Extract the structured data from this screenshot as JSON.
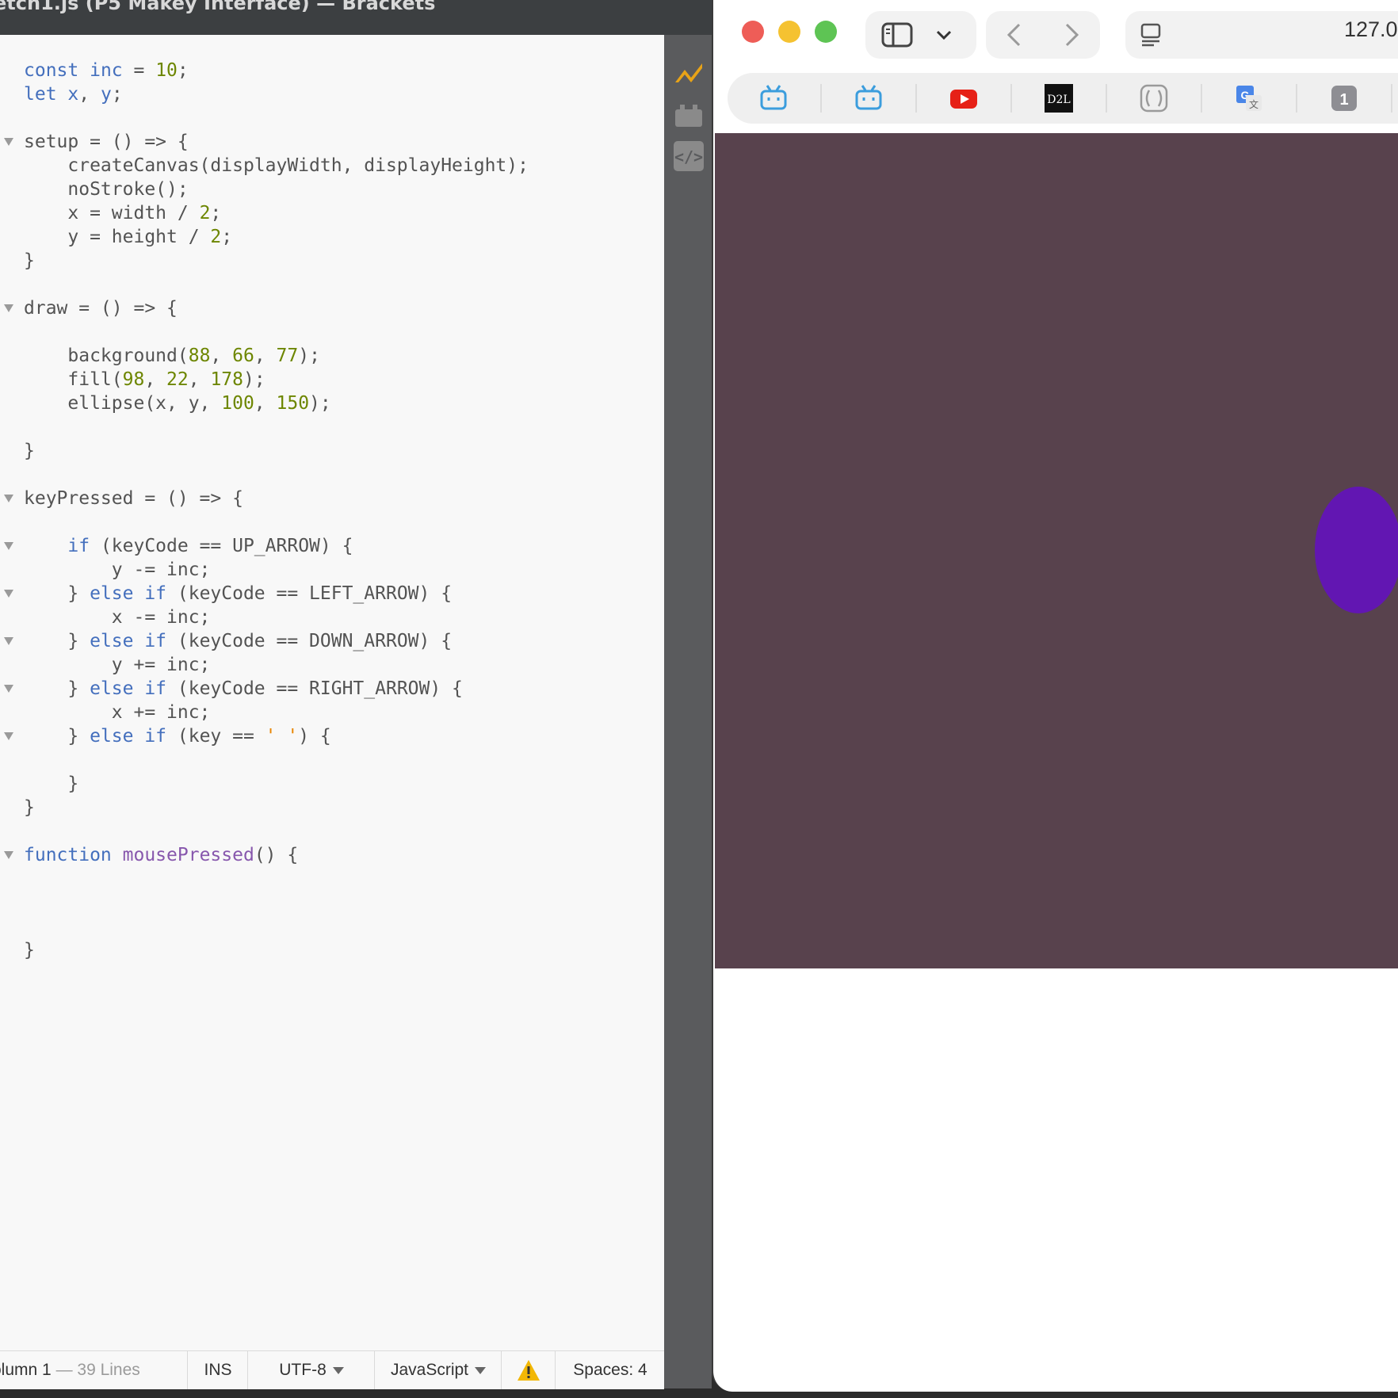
{
  "editor": {
    "title": "etch1.js (P5 Makey Interface) — Brackets",
    "code_lines": [
      {
        "fold": false,
        "html": "<span class=\"kw\">const</span> <span class=\"v\">inc</span> = <span class=\"num\">10</span>;"
      },
      {
        "fold": false,
        "html": "<span class=\"kw\">let</span> <span class=\"v\">x</span>, <span class=\"v\">y</span>;"
      },
      {
        "fold": false,
        "html": ""
      },
      {
        "fold": true,
        "html": "setup = () => {"
      },
      {
        "fold": false,
        "html": "    createCanvas(displayWidth, displayHeight);"
      },
      {
        "fold": false,
        "html": "    noStroke();"
      },
      {
        "fold": false,
        "html": "    x = width / <span class=\"num\">2</span>;"
      },
      {
        "fold": false,
        "html": "    y = height / <span class=\"num\">2</span>;"
      },
      {
        "fold": false,
        "html": "}"
      },
      {
        "fold": false,
        "html": ""
      },
      {
        "fold": true,
        "html": "draw = () => {"
      },
      {
        "fold": false,
        "html": ""
      },
      {
        "fold": false,
        "html": "    background(<span class=\"num\">88</span>, <span class=\"num\">66</span>, <span class=\"num\">77</span>);"
      },
      {
        "fold": false,
        "html": "    fill(<span class=\"num\">98</span>, <span class=\"num\">22</span>, <span class=\"num\">178</span>);"
      },
      {
        "fold": false,
        "html": "    ellipse(x, y, <span class=\"num\">100</span>, <span class=\"num\">150</span>);"
      },
      {
        "fold": false,
        "html": ""
      },
      {
        "fold": false,
        "html": "}"
      },
      {
        "fold": false,
        "html": ""
      },
      {
        "fold": true,
        "html": "keyPressed = () => {"
      },
      {
        "fold": false,
        "html": ""
      },
      {
        "fold": true,
        "html": "    <span class=\"kw\">if</span> (keyCode == UP_ARROW) {"
      },
      {
        "fold": false,
        "html": "        y -= inc;"
      },
      {
        "fold": true,
        "html": "    } <span class=\"kw\">else if</span> (keyCode == LEFT_ARROW) {"
      },
      {
        "fold": false,
        "html": "        x -= inc;"
      },
      {
        "fold": true,
        "html": "    } <span class=\"kw\">else if</span> (keyCode == DOWN_ARROW) {"
      },
      {
        "fold": false,
        "html": "        y += inc;"
      },
      {
        "fold": true,
        "html": "    } <span class=\"kw\">else if</span> (keyCode == RIGHT_ARROW) {"
      },
      {
        "fold": false,
        "html": "        x += inc;"
      },
      {
        "fold": true,
        "html": "    } <span class=\"kw\">else if</span> (key == <span class=\"str\">' '</span>) {"
      },
      {
        "fold": false,
        "html": ""
      },
      {
        "fold": false,
        "html": "    }"
      },
      {
        "fold": false,
        "html": "}"
      },
      {
        "fold": false,
        "html": ""
      },
      {
        "fold": true,
        "html": "<span class=\"kw\">function</span> <span class=\"fn\">mousePressed</span>() {"
      },
      {
        "fold": false,
        "html": ""
      },
      {
        "fold": false,
        "html": ""
      },
      {
        "fold": false,
        "html": ""
      },
      {
        "fold": false,
        "html": "}"
      }
    ],
    "status": {
      "position": "olumn 1",
      "lines": "— 39 Lines",
      "mode": "INS",
      "encoding": "UTF-8",
      "language": "JavaScript",
      "spaces_label": "Spaces:",
      "spaces_value": "4"
    }
  },
  "browser": {
    "url": "127.0.",
    "favorites": [
      "bilibili",
      "bilibili",
      "youtube",
      "D2L",
      "arc",
      "google-translate",
      "1"
    ],
    "canvas_color": "#58424d",
    "ellipse_color": "#6216b2"
  }
}
